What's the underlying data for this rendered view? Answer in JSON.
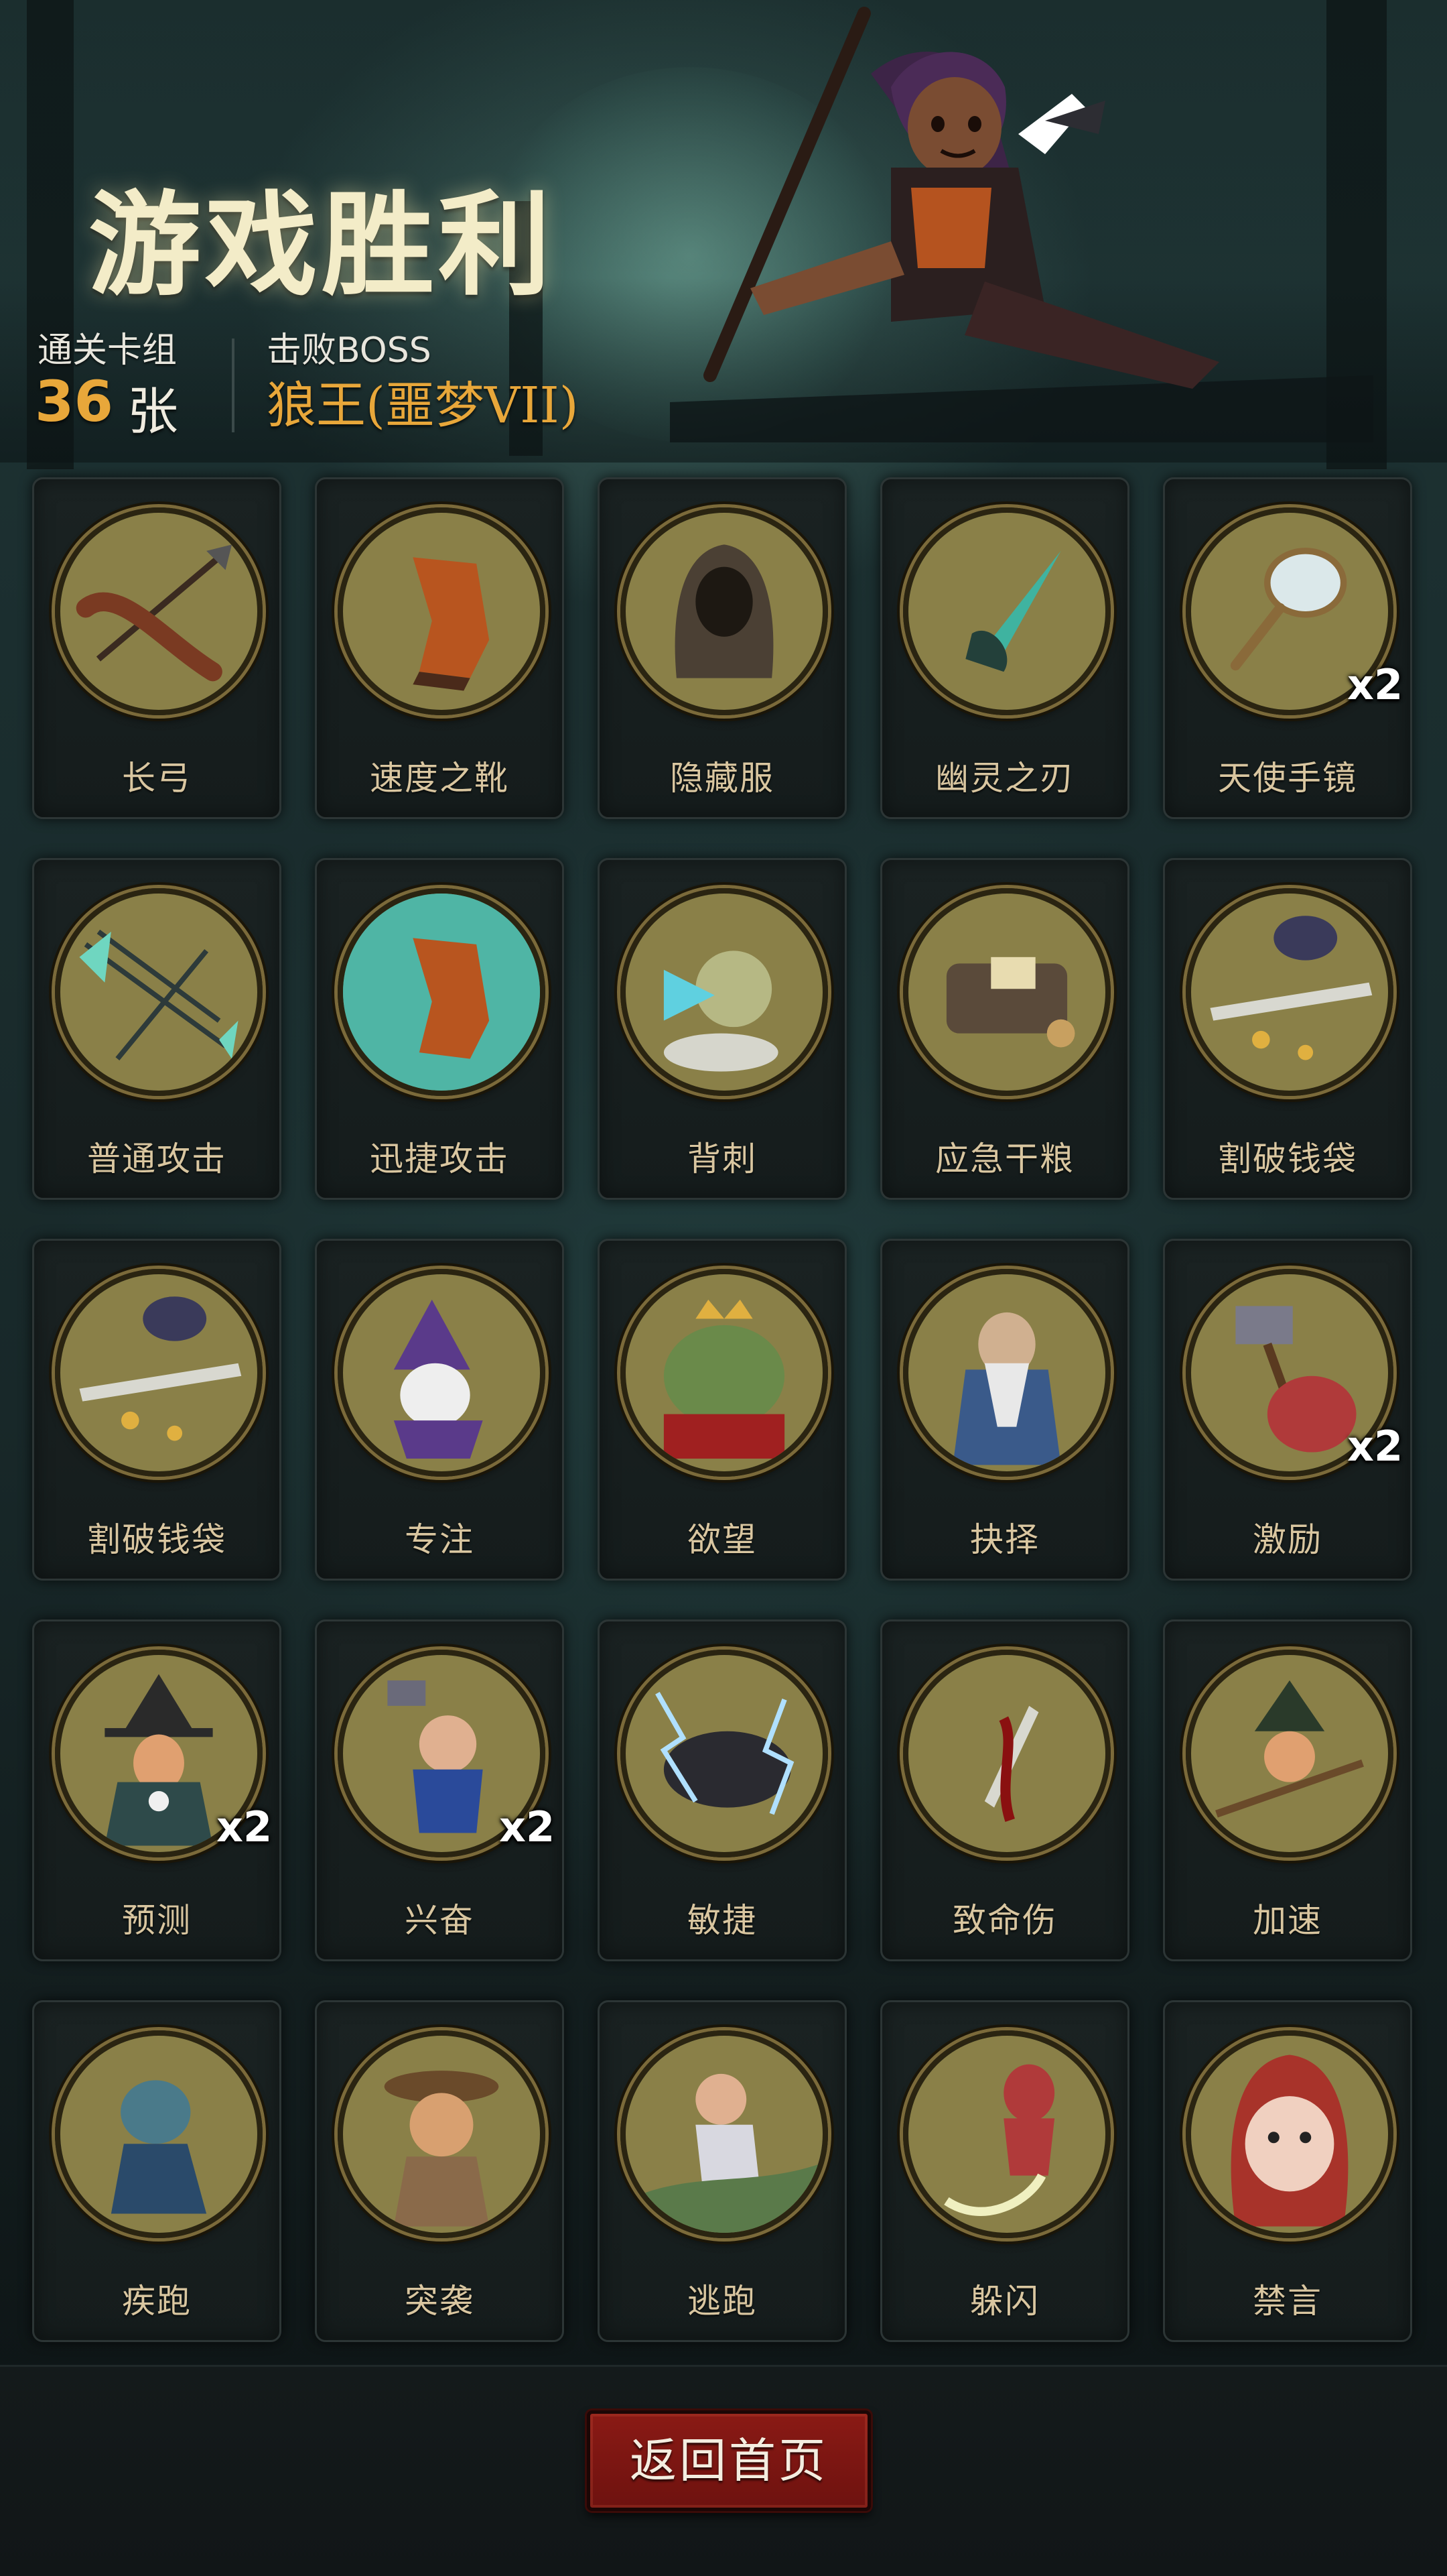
{
  "header": {
    "title": "游戏胜利",
    "deck_label": "通关卡组",
    "deck_count": "36",
    "deck_unit": "张",
    "boss_label": "击败BOSS",
    "boss_name": "狼王(噩梦VII)"
  },
  "cards": [
    {
      "name": "长弓",
      "icon": "longbow-icon",
      "count": ""
    },
    {
      "name": "速度之靴",
      "icon": "speed-boots-icon",
      "count": ""
    },
    {
      "name": "隐藏服",
      "icon": "hooded-cloak-icon",
      "count": ""
    },
    {
      "name": "幽灵之刃",
      "icon": "ghost-blade-icon",
      "count": ""
    },
    {
      "name": "天使手镜",
      "icon": "angel-hand-mirror-icon",
      "count": "x2"
    },
    {
      "name": "普通攻击",
      "icon": "arrow-volley-icon",
      "count": ""
    },
    {
      "name": "迅捷攻击",
      "icon": "swift-boot-strike-icon",
      "count": ""
    },
    {
      "name": "背刺",
      "icon": "backstab-icon",
      "count": ""
    },
    {
      "name": "应急干粮",
      "icon": "emergency-rations-icon",
      "count": ""
    },
    {
      "name": "割破钱袋",
      "icon": "cut-purse-icon",
      "count": ""
    },
    {
      "name": "割破钱袋",
      "icon": "cut-purse-icon",
      "count": ""
    },
    {
      "name": "专注",
      "icon": "wizard-focus-icon",
      "count": ""
    },
    {
      "name": "欲望",
      "icon": "greedy-toad-king-icon",
      "count": ""
    },
    {
      "name": "抉择",
      "icon": "old-sage-icon",
      "count": ""
    },
    {
      "name": "激励",
      "icon": "hammer-warrior-icon",
      "count": "x2"
    },
    {
      "name": "预测",
      "icon": "witch-orb-icon",
      "count": "x2"
    },
    {
      "name": "兴奋",
      "icon": "excited-dwarf-icon",
      "count": "x2"
    },
    {
      "name": "敏捷",
      "icon": "lightning-panther-icon",
      "count": ""
    },
    {
      "name": "致命伤",
      "icon": "bloody-dagger-icon",
      "count": ""
    },
    {
      "name": "加速",
      "icon": "broom-witch-icon",
      "count": ""
    },
    {
      "name": "疾跑",
      "icon": "running-wolf-icon",
      "count": ""
    },
    {
      "name": "突袭",
      "icon": "ambush-bandit-icon",
      "count": ""
    },
    {
      "name": "逃跑",
      "icon": "fleeing-boy-icon",
      "count": ""
    },
    {
      "name": "躲闪",
      "icon": "dodging-hood-icon",
      "count": ""
    },
    {
      "name": "禁言",
      "icon": "silence-red-hood-icon",
      "count": ""
    }
  ],
  "footer": {
    "home_button": "返回首页"
  },
  "colors": {
    "title": "#f3ecc8",
    "accent_gold": "#e8a73a",
    "card_label": "#d9c6a0",
    "icon_bg": "#8a8048",
    "button_red": "#7d1712"
  }
}
